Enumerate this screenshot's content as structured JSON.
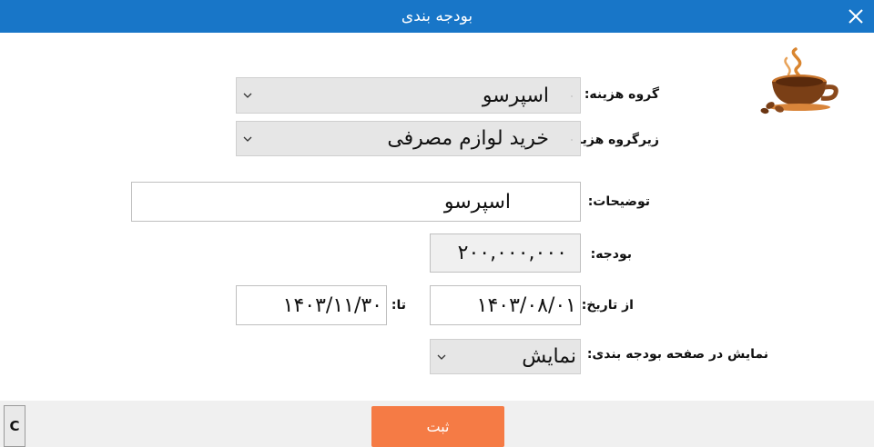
{
  "window": {
    "title": "بودجه بندی",
    "close_icon": "close-icon"
  },
  "logo": {
    "icon": "coffee-cup-icon"
  },
  "form": {
    "expense_group": {
      "label": "گروه هزینه:",
      "value": "اسپرسو"
    },
    "expense_subgroup": {
      "label": "زیرگروه هزینه:",
      "value": "خرید لوازم مصرفی"
    },
    "description": {
      "label": "توضیحات:",
      "value": "اسپرسو"
    },
    "budget": {
      "label": "بودجه:",
      "value": "۲۰۰,۰۰۰,۰۰۰"
    },
    "date_from": {
      "label": "از تاریخ:",
      "value": "۱۴۰۳/۰۸/۰۱"
    },
    "date_to": {
      "label": "تا:",
      "value": "۱۴۰۳/۱۱/۳۰"
    },
    "show_in_budget_page": {
      "label": "نمایش در صفحه بودجه بندی:",
      "value": "نمایش"
    }
  },
  "footer": {
    "clear_label": "C",
    "submit_label": "ثبت"
  },
  "colors": {
    "titlebar": "#1876c8",
    "submit": "#f57b45",
    "footer": "#f0f0f0"
  }
}
